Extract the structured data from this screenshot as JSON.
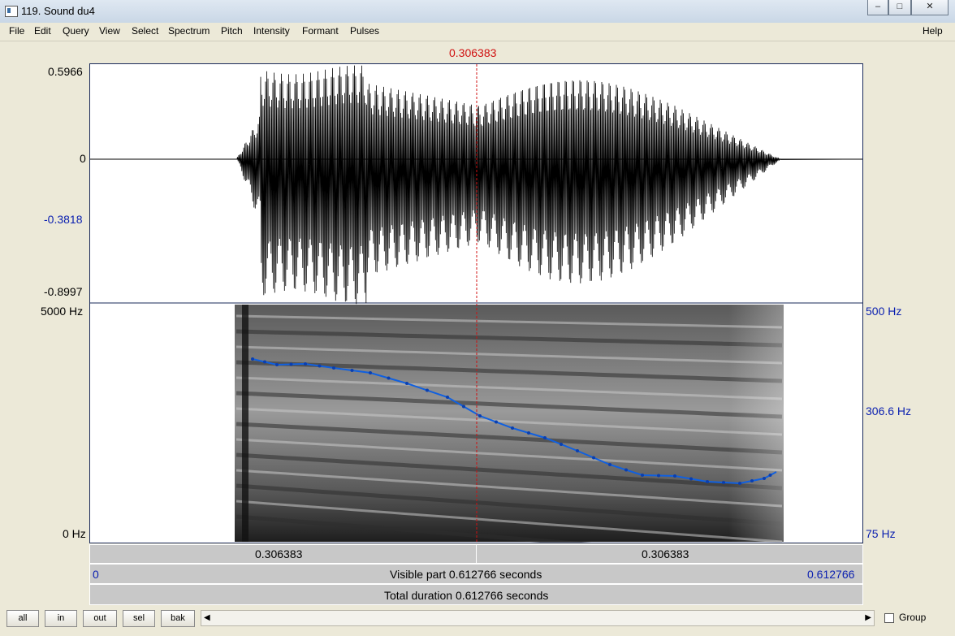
{
  "window": {
    "title": "119. Sound du4",
    "minimize_icon": "minimize-icon",
    "maximize_icon": "maximize-icon",
    "close_icon": "close-icon"
  },
  "menu": {
    "items": [
      "File",
      "Edit",
      "Query",
      "View",
      "Select",
      "Spectrum",
      "Pitch",
      "Intensity",
      "Formant",
      "Pulses"
    ],
    "help": "Help"
  },
  "cursor": {
    "time": "0.306383"
  },
  "waveform": {
    "ymax": "0.5966",
    "yzero": "0",
    "ycursor": "-0.3818",
    "ymin": "-0.8997"
  },
  "spectrogram": {
    "fmax": "5000 Hz",
    "fmin": "0 Hz"
  },
  "pitch": {
    "max": "500 Hz",
    "mid": "306.6 Hz",
    "min": "75 Hz"
  },
  "timebar": {
    "left": "0.306383",
    "right": "0.306383"
  },
  "visible": {
    "start": "0",
    "label": "Visible part 0.612766 seconds",
    "end": "0.612766"
  },
  "total": {
    "label": "Total duration 0.612766 seconds"
  },
  "buttons": {
    "all": "all",
    "in": "in",
    "out": "out",
    "sel": "sel",
    "bak": "bak"
  },
  "group": {
    "label": "Group",
    "checked": false
  },
  "colors": {
    "cursor": "#d01010",
    "pitch_curve": "#1060e0",
    "pitch_label": "#0a1fb0"
  }
}
